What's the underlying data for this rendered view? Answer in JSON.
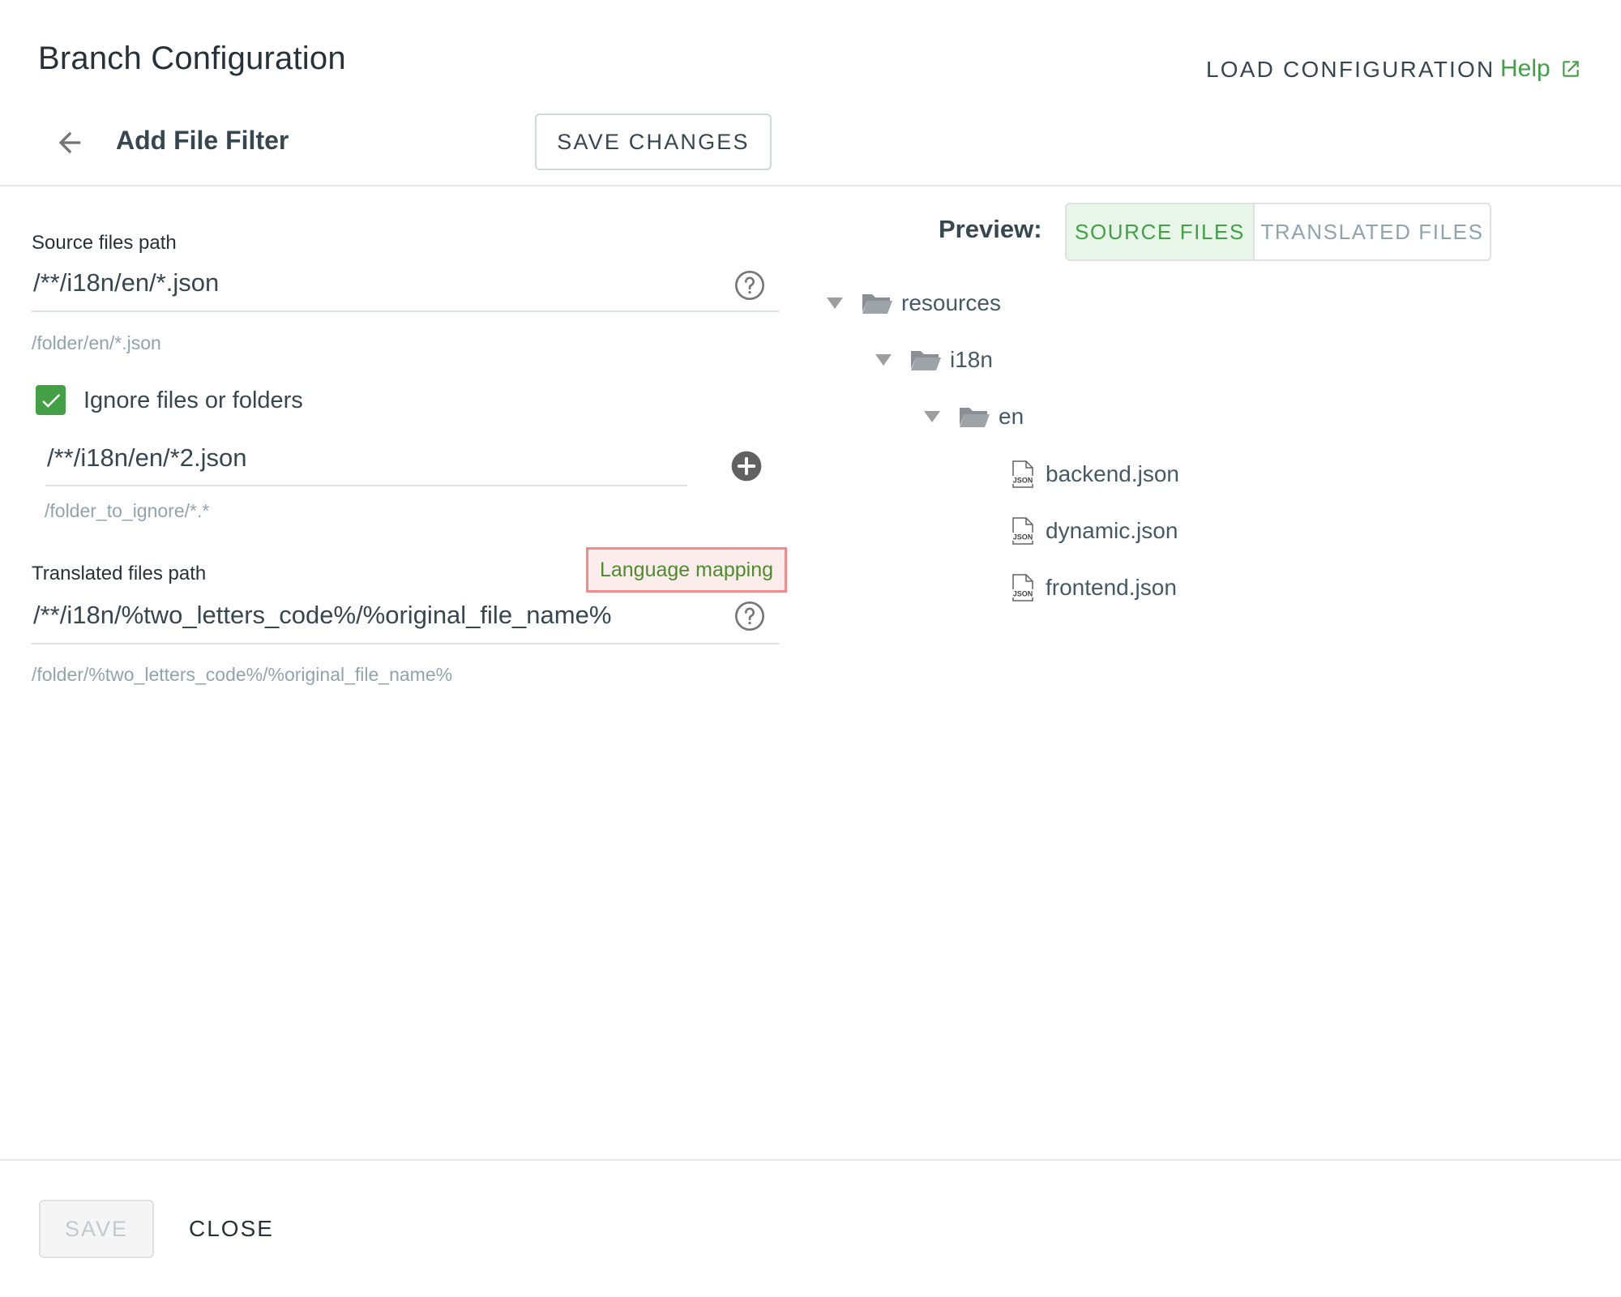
{
  "header": {
    "title": "Branch Configuration",
    "load_configuration": "LOAD CONFIGURATION",
    "help": "Help",
    "subtitle": "Add File Filter",
    "save_changes": "SAVE CHANGES"
  },
  "source": {
    "label": "Source files path",
    "value": "/**/i18n/en/*.json",
    "hint": "/folder/en/*.json"
  },
  "ignore": {
    "checked": true,
    "label": "Ignore files or folders",
    "value": "/**/i18n/en/*2.json",
    "hint": "/folder_to_ignore/*.*"
  },
  "translated": {
    "label": "Translated files path",
    "language_mapping": "Language mapping",
    "value": "/**/i18n/%two_letters_code%/%original_file_name%",
    "hint": "/folder/%two_letters_code%/%original_file_name%"
  },
  "preview": {
    "label": "Preview:",
    "tabs": [
      "SOURCE FILES",
      "TRANSLATED FILES"
    ],
    "active_tab": "SOURCE FILES",
    "tree": {
      "folders": [
        "resources",
        "i18n",
        "en"
      ],
      "files": [
        "backend.json",
        "dynamic.json",
        "frontend.json"
      ]
    }
  },
  "footer": {
    "save": "SAVE",
    "close": "CLOSE"
  },
  "colors": {
    "accent_green": "#43a047",
    "highlight_border": "#ef8b8b",
    "text_dark": "#263238",
    "hint_gray": "#90a4ae"
  },
  "icons": [
    "arrow-back-icon",
    "external-link-icon",
    "help-circle-icon",
    "check-icon",
    "add-circle-icon",
    "caret-down-icon",
    "folder-open-icon",
    "json-file-icon"
  ]
}
